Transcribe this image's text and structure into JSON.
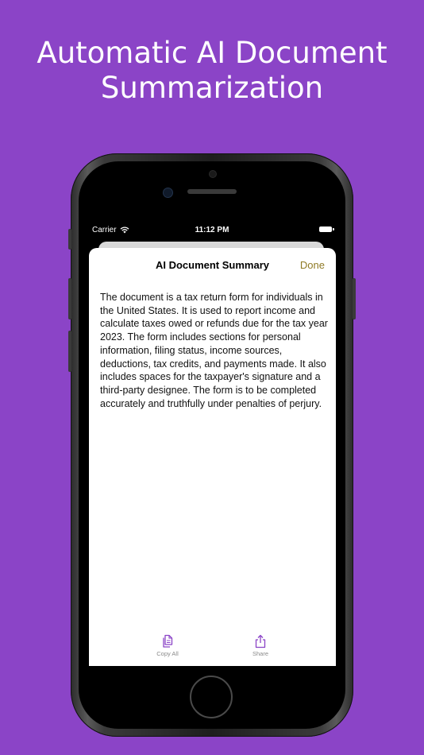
{
  "headline": {
    "line1": "Automatic AI Document",
    "line2": "Summarization"
  },
  "status_bar": {
    "carrier": "Carrier",
    "time": "11:12 PM"
  },
  "sheet": {
    "title": "AI Document Summary",
    "done_label": "Done",
    "summary": "The document is a tax return form for individuals in the United States. It is used to report income and calculate taxes owed or refunds due for the tax year 2023. The form includes sections for personal information, filing status, income sources, deductions, tax credits, and payments made. It also includes spaces for the taxpayer's signature and a third-party designee. The form is to be completed accurately and truthfully under penalties of perjury."
  },
  "toolbar": {
    "copy_label": "Copy All",
    "share_label": "Share"
  },
  "colors": {
    "background": "#8b44c7",
    "accent": "#8b44c7",
    "done": "#8f7a25"
  },
  "icons": {
    "copy": "copy-icon",
    "share": "share-icon",
    "wifi": "wifi-icon",
    "battery": "battery-icon"
  }
}
